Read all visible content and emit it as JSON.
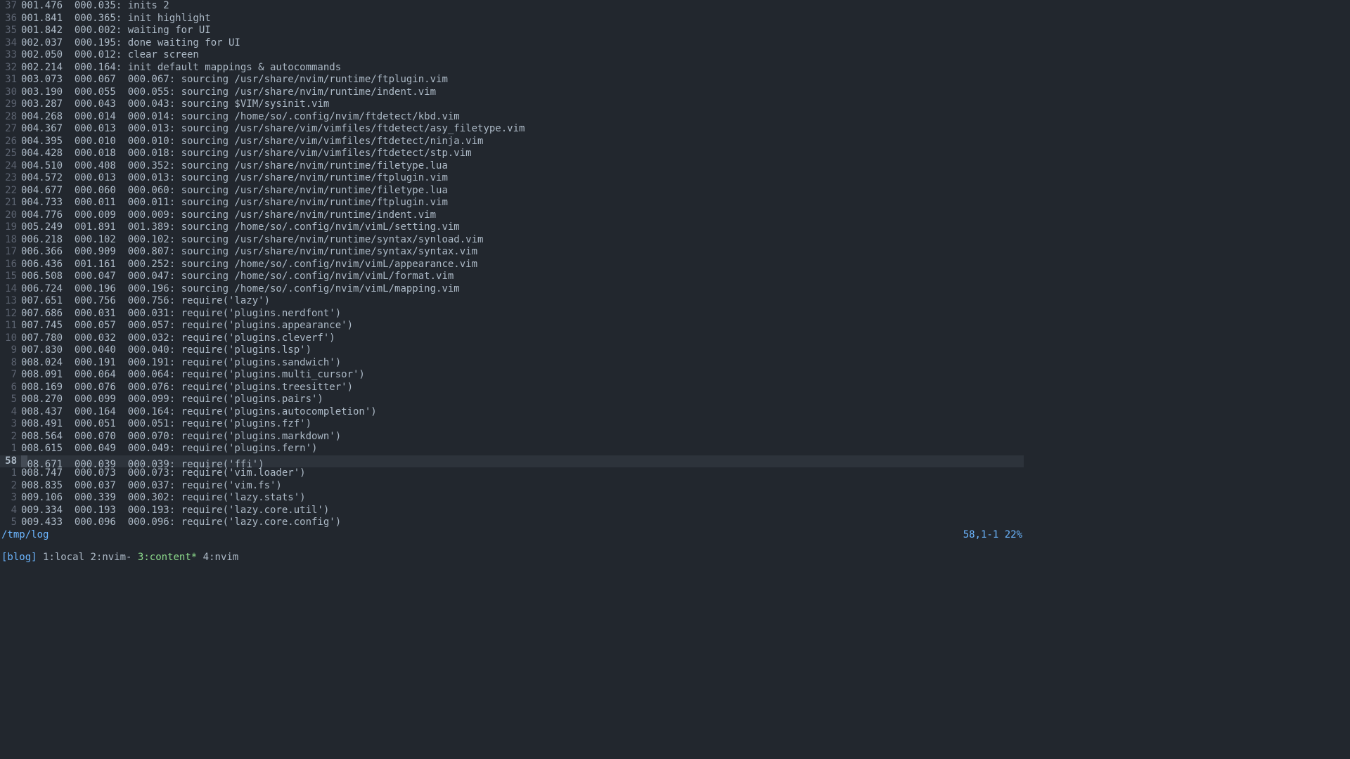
{
  "lines": [
    {
      "rel": "37",
      "text": "001.476  000.035: inits 2"
    },
    {
      "rel": "36",
      "text": "001.841  000.365: init highlight"
    },
    {
      "rel": "35",
      "text": "001.842  000.002: waiting for UI"
    },
    {
      "rel": "34",
      "text": "002.037  000.195: done waiting for UI"
    },
    {
      "rel": "33",
      "text": "002.050  000.012: clear screen"
    },
    {
      "rel": "32",
      "text": "002.214  000.164: init default mappings & autocommands"
    },
    {
      "rel": "31",
      "text": "003.073  000.067  000.067: sourcing /usr/share/nvim/runtime/ftplugin.vim"
    },
    {
      "rel": "30",
      "text": "003.190  000.055  000.055: sourcing /usr/share/nvim/runtime/indent.vim"
    },
    {
      "rel": "29",
      "text": "003.287  000.043  000.043: sourcing $VIM/sysinit.vim"
    },
    {
      "rel": "28",
      "text": "004.268  000.014  000.014: sourcing /home/so/.config/nvim/ftdetect/kbd.vim"
    },
    {
      "rel": "27",
      "text": "004.367  000.013  000.013: sourcing /usr/share/vim/vimfiles/ftdetect/asy_filetype.vim"
    },
    {
      "rel": "26",
      "text": "004.395  000.010  000.010: sourcing /usr/share/vim/vimfiles/ftdetect/ninja.vim"
    },
    {
      "rel": "25",
      "text": "004.428  000.018  000.018: sourcing /usr/share/vim/vimfiles/ftdetect/stp.vim"
    },
    {
      "rel": "24",
      "text": "004.510  000.408  000.352: sourcing /usr/share/nvim/runtime/filetype.lua"
    },
    {
      "rel": "23",
      "text": "004.572  000.013  000.013: sourcing /usr/share/nvim/runtime/ftplugin.vim"
    },
    {
      "rel": "22",
      "text": "004.677  000.060  000.060: sourcing /usr/share/nvim/runtime/filetype.lua"
    },
    {
      "rel": "21",
      "text": "004.733  000.011  000.011: sourcing /usr/share/nvim/runtime/ftplugin.vim"
    },
    {
      "rel": "20",
      "text": "004.776  000.009  000.009: sourcing /usr/share/nvim/runtime/indent.vim"
    },
    {
      "rel": "19",
      "text": "005.249  001.891  001.389: sourcing /home/so/.config/nvim/vimL/setting.vim"
    },
    {
      "rel": "18",
      "text": "006.218  000.102  000.102: sourcing /usr/share/nvim/runtime/syntax/synload.vim"
    },
    {
      "rel": "17",
      "text": "006.366  000.909  000.807: sourcing /usr/share/nvim/runtime/syntax/syntax.vim"
    },
    {
      "rel": "16",
      "text": "006.436  001.161  000.252: sourcing /home/so/.config/nvim/vimL/appearance.vim"
    },
    {
      "rel": "15",
      "text": "006.508  000.047  000.047: sourcing /home/so/.config/nvim/vimL/format.vim"
    },
    {
      "rel": "14",
      "text": "006.724  000.196  000.196: sourcing /home/so/.config/nvim/vimL/mapping.vim"
    },
    {
      "rel": "13",
      "text": "007.651  000.756  000.756: require('lazy')"
    },
    {
      "rel": "12",
      "text": "007.686  000.031  000.031: require('plugins.nerdfont')"
    },
    {
      "rel": "11",
      "text": "007.745  000.057  000.057: require('plugins.appearance')"
    },
    {
      "rel": "10",
      "text": "007.780  000.032  000.032: require('plugins.cleverf')"
    },
    {
      "rel": "9",
      "text": "007.830  000.040  000.040: require('plugins.lsp')"
    },
    {
      "rel": "8",
      "text": "008.024  000.191  000.191: require('plugins.sandwich')"
    },
    {
      "rel": "7",
      "text": "008.091  000.064  000.064: require('plugins.multi_cursor')"
    },
    {
      "rel": "6",
      "text": "008.169  000.076  000.076: require('plugins.treesitter')"
    },
    {
      "rel": "5",
      "text": "008.270  000.099  000.099: require('plugins.pairs')"
    },
    {
      "rel": "4",
      "text": "008.437  000.164  000.164: require('plugins.autocompletion')"
    },
    {
      "rel": "3",
      "text": "008.491  000.051  000.051: require('plugins.fzf')"
    },
    {
      "rel": "2",
      "text": "008.564  000.070  000.070: require('plugins.markdown')"
    },
    {
      "rel": "1",
      "text": "008.615  000.049  000.049: require('plugins.fern')"
    },
    {
      "rel": "58",
      "text": "008.671  000.039  000.039: require('ffi')",
      "cursor": true,
      "abs": true
    },
    {
      "rel": "1",
      "text": "008.747  000.073  000.073: require('vim.loader')"
    },
    {
      "rel": "2",
      "text": "008.835  000.037  000.037: require('vim.fs')"
    },
    {
      "rel": "3",
      "text": "009.106  000.339  000.302: require('lazy.stats')"
    },
    {
      "rel": "4",
      "text": "009.334  000.193  000.193: require('lazy.core.util')"
    },
    {
      "rel": "5",
      "text": "009.433  000.096  000.096: require('lazy.core.config')"
    }
  ],
  "status": {
    "left": "/tmp/log",
    "right": "58,1-1 22%"
  },
  "tmux": {
    "session": "[blog]",
    "windows": [
      {
        "label": "1:local",
        "active": false
      },
      {
        "label": "2:nvim-",
        "active": false
      },
      {
        "label": "3:content*",
        "active": true
      },
      {
        "label": "4:nvim",
        "active": false
      }
    ]
  }
}
